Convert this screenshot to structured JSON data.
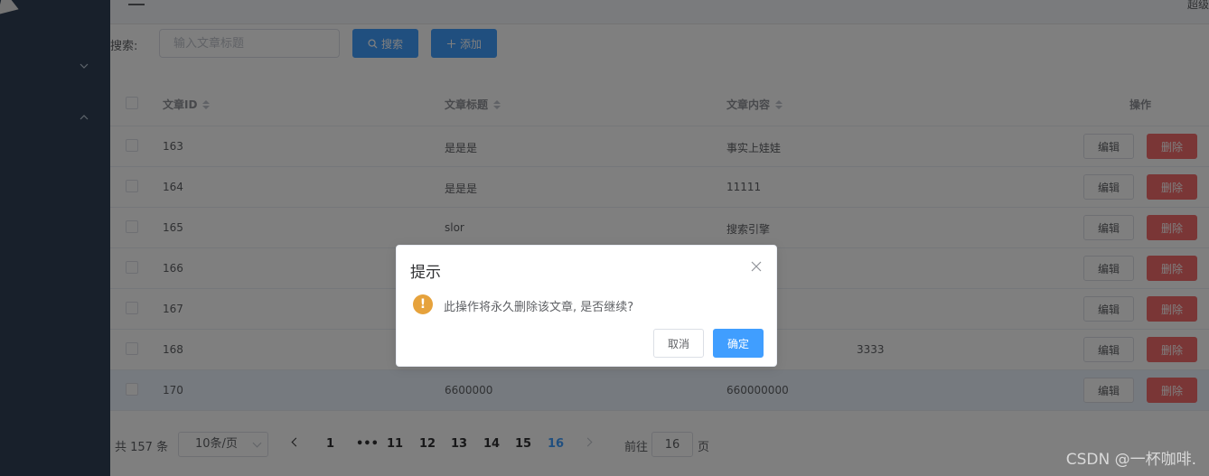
{
  "header": {
    "user_name": "超级"
  },
  "search": {
    "label": "搜索:",
    "placeholder": "输入文章标题",
    "search_button": "搜索",
    "add_button": "添加"
  },
  "table": {
    "columns": {
      "id": "文章ID",
      "title": "文章标题",
      "content": "文章内容",
      "ops": "操作"
    },
    "rows": [
      {
        "id": "163",
        "title": "是是是",
        "content": "事实上娃娃"
      },
      {
        "id": "164",
        "title": "是是是",
        "content": "11111"
      },
      {
        "id": "165",
        "title": "slor",
        "content": "搜索引擎"
      },
      {
        "id": "166",
        "title": "",
        "content": ""
      },
      {
        "id": "167",
        "title": "",
        "content": ""
      },
      {
        "id": "168",
        "title": "",
        "content": "3333"
      },
      {
        "id": "170",
        "title": "6600000",
        "content": "660000000"
      }
    ],
    "edit_label": "编辑",
    "delete_label": "删除"
  },
  "pagination": {
    "total": "共 157 条",
    "page_size": "10条/页",
    "pages": [
      "1",
      "•••",
      "11",
      "12",
      "13",
      "14",
      "15",
      "16"
    ],
    "active_page": "16",
    "goto_label": "前往",
    "goto_value": "16",
    "goto_suffix": "页"
  },
  "dialog": {
    "title": "提示",
    "icon": "!",
    "message": "此操作将永久删除该文章, 是否继续?",
    "cancel": "取消",
    "confirm": "确定"
  },
  "watermark": "CSDN @一杯咖啡.",
  "colors": {
    "primary": "#409eff",
    "danger": "#f56c6c",
    "warning": "#e6a23c",
    "sidebar": "#304156"
  }
}
